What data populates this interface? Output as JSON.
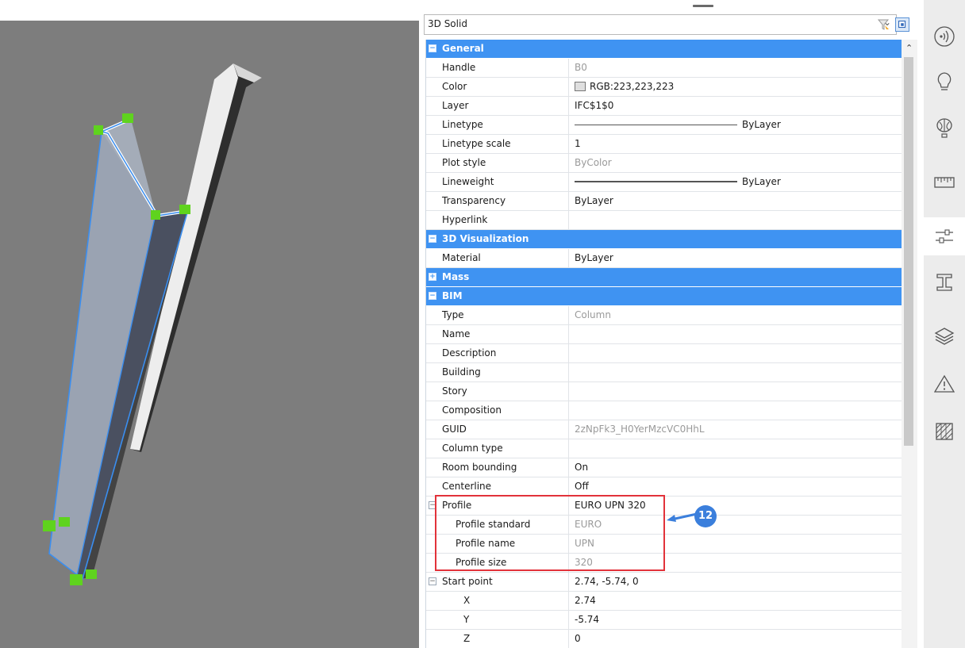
{
  "selector": {
    "value": "3D Solid"
  },
  "sections": {
    "general": "General",
    "visualization": "3D Visualization",
    "mass": "Mass",
    "bim": "BIM"
  },
  "rows": {
    "handle": {
      "label": "Handle",
      "value": "B0"
    },
    "color": {
      "label": "Color",
      "value": "RGB:223,223,223"
    },
    "layer": {
      "label": "Layer",
      "value": "IFC$1$0"
    },
    "linetype": {
      "label": "Linetype",
      "value": "ByLayer"
    },
    "linetype_scale": {
      "label": "Linetype scale",
      "value": "1"
    },
    "plot_style": {
      "label": "Plot style",
      "value": "ByColor"
    },
    "lineweight": {
      "label": "Lineweight",
      "value": "ByLayer"
    },
    "transparency": {
      "label": "Transparency",
      "value": "ByLayer"
    },
    "hyperlink": {
      "label": "Hyperlink",
      "value": ""
    },
    "material": {
      "label": "Material",
      "value": "ByLayer"
    },
    "type": {
      "label": "Type",
      "value": "Column"
    },
    "name": {
      "label": "Name",
      "value": ""
    },
    "description": {
      "label": "Description",
      "value": ""
    },
    "building": {
      "label": "Building",
      "value": ""
    },
    "story": {
      "label": "Story",
      "value": ""
    },
    "composition": {
      "label": "Composition",
      "value": ""
    },
    "guid": {
      "label": "GUID",
      "value": "2zNpFk3_H0YerMzcVC0HhL"
    },
    "column_type": {
      "label": "Column type",
      "value": ""
    },
    "room_bounding": {
      "label": "Room bounding",
      "value": "On"
    },
    "centerline": {
      "label": "Centerline",
      "value": "Off"
    },
    "profile": {
      "label": "Profile",
      "value": "EURO UPN 320"
    },
    "profile_standard": {
      "label": "Profile standard",
      "value": "EURO"
    },
    "profile_name": {
      "label": "Profile name",
      "value": "UPN"
    },
    "profile_size": {
      "label": "Profile size",
      "value": "320"
    },
    "start_point": {
      "label": "Start point",
      "value": "2.74, -5.74, 0"
    },
    "x": {
      "label": "X",
      "value": "2.74"
    },
    "y": {
      "label": "Y",
      "value": "-5.74"
    },
    "z": {
      "label": "Z",
      "value": "0"
    }
  },
  "callout": {
    "number": "12"
  },
  "colors": {
    "accent": "#3f93f2",
    "highlight": "#e2323a",
    "grip": "#5fd31e"
  },
  "iconbar": [
    "sound-icon",
    "lightbulb-icon",
    "balloon-icon",
    "ruler-icon",
    "properties-sliders-icon",
    "i-beam-icon",
    "layers-icon",
    "warning-icon",
    "hatch-icon"
  ]
}
